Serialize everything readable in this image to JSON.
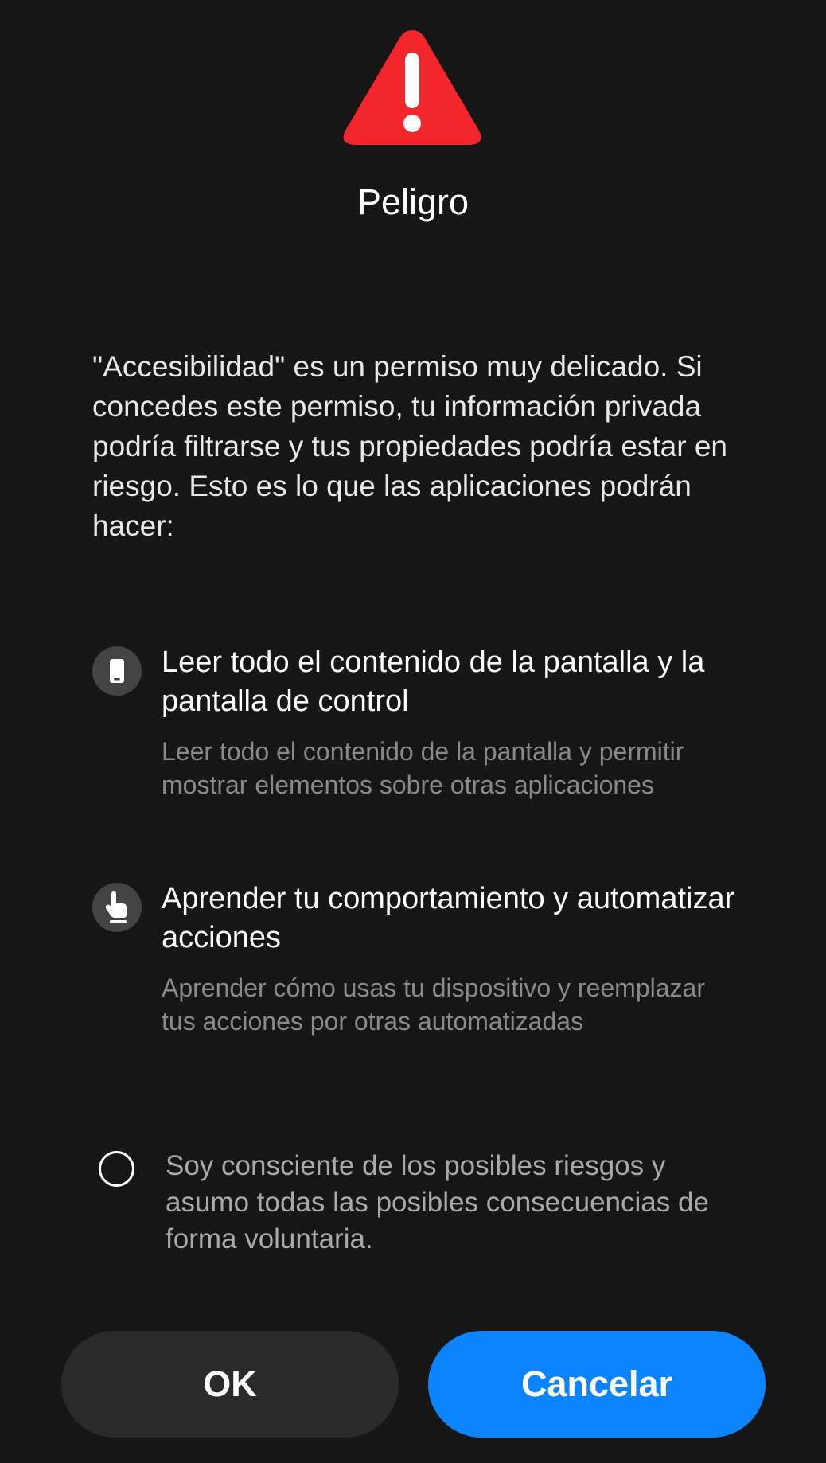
{
  "dialog": {
    "title": "Peligro",
    "message": "\"Accesibilidad\" es un permiso muy delicado. Si concedes este permiso, tu información privada podría filtrarse y tus propiedades podría estar en riesgo. Esto es lo que las aplicaciones podrán hacer:",
    "colors": {
      "background": "#161616",
      "warning": "#f2262b",
      "primary_button": "#0d84ff",
      "secondary_button": "#2a2a2a"
    }
  },
  "permissions": [
    {
      "icon": "phone-icon",
      "title": "Leer todo el contenido de la pantalla y la pantalla de control",
      "description": "Leer todo el contenido de la pantalla y permitir mostrar elementos sobre otras aplicaciones"
    },
    {
      "icon": "hand-pointer-icon",
      "title": "Aprender tu comportamiento y automatizar acciones",
      "description": "Aprender cómo usas tu dispositivo y reemplazar tus acciones por otras automatizadas"
    }
  ],
  "consent": {
    "checked": false,
    "text": "Soy consciente de los posibles riesgos y asumo todas las posibles consecuencias de forma voluntaria."
  },
  "buttons": {
    "ok_label": "OK",
    "cancel_label": "Cancelar"
  }
}
